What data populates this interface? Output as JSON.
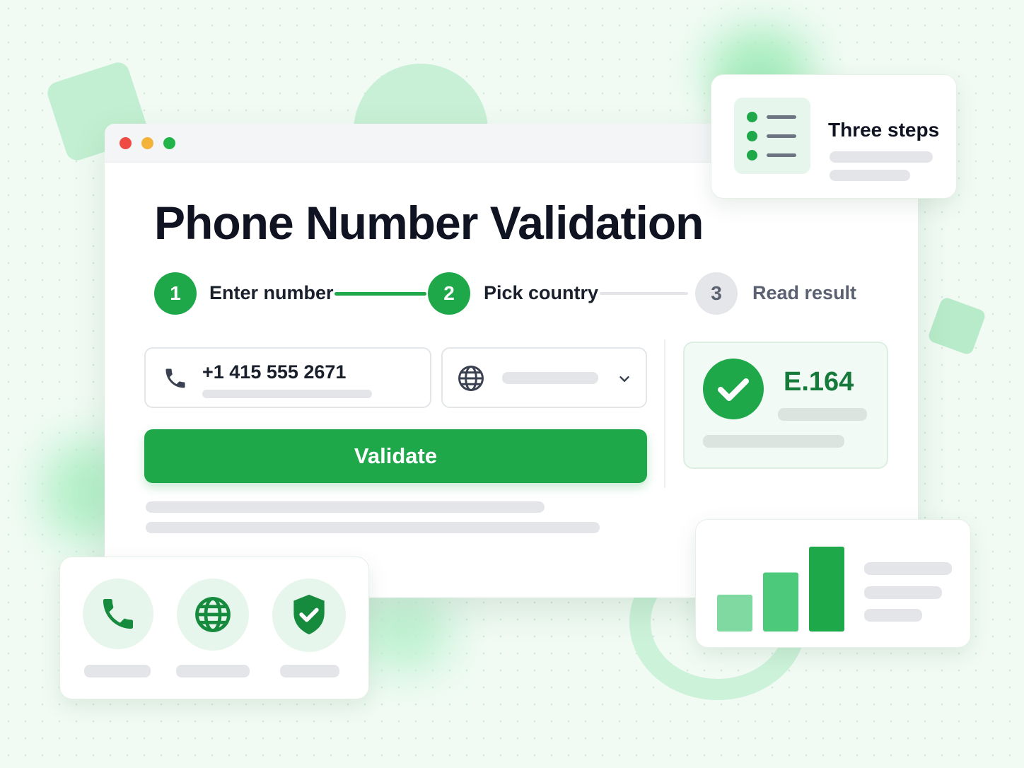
{
  "window": {
    "title": "Phone Number Validation"
  },
  "steps": [
    {
      "number": "1",
      "label": "Enter number"
    },
    {
      "number": "2",
      "label": "Pick country"
    },
    {
      "number": "3",
      "label": "Read result"
    }
  ],
  "form": {
    "phone_value": "+1 415 555 2671",
    "phone_icon": "phone-icon",
    "country_icon": "globe-icon",
    "dropdown_icon": "chevron-down-icon",
    "validate_label": "Validate"
  },
  "result": {
    "icon": "check-circle-icon",
    "format": "E.164"
  },
  "callout_steps": {
    "icon": "list-icon",
    "title": "Three steps"
  },
  "feature_icons": [
    "phone-icon",
    "globe-icon",
    "shield-check-icon"
  ],
  "bar_chart": {
    "values": [
      1,
      1.6,
      2.3
    ]
  },
  "colors": {
    "accent": "#1fa84a",
    "accent_light": "#4cc97a",
    "accent_lighter": "#7fd9a0",
    "pending_step": "#e4e6ea",
    "traffic_red": "#ef4a43",
    "traffic_yellow": "#f3b33a",
    "traffic_green": "#22b34a"
  }
}
